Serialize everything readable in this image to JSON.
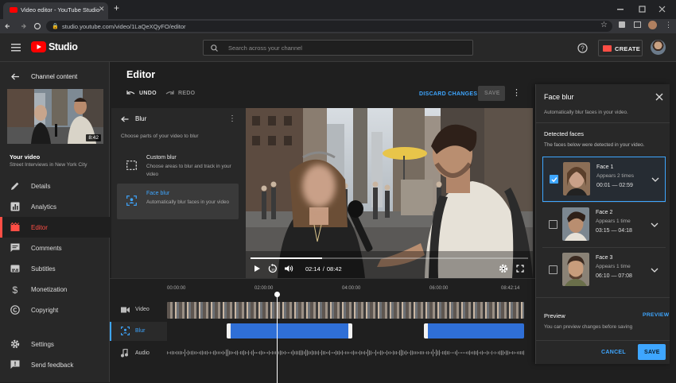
{
  "browser": {
    "tab_title": "Video editor - YouTube Studio",
    "url": "studio.youtube.com/video/1LaQeXQyFO/editor"
  },
  "header": {
    "logo_text": "Studio",
    "search_placeholder": "Search across your channel",
    "create_label": "CREATE"
  },
  "sidebar": {
    "back_label": "Channel content",
    "video_duration": "8:42",
    "your_video_label": "Your video",
    "video_title": "Street Interviews in New York City",
    "items": [
      {
        "label": "Details",
        "icon": "pencil-icon"
      },
      {
        "label": "Analytics",
        "icon": "analytics-icon"
      },
      {
        "label": "Editor",
        "icon": "editor-icon"
      },
      {
        "label": "Comments",
        "icon": "comments-icon"
      },
      {
        "label": "Subtitles",
        "icon": "subtitles-icon"
      },
      {
        "label": "Monetization",
        "icon": "dollar-icon"
      },
      {
        "label": "Copyright",
        "icon": "copyright-icon"
      }
    ],
    "bottom_items": [
      {
        "label": "Settings",
        "icon": "gear-icon"
      },
      {
        "label": "Send feedback",
        "icon": "feedback-icon"
      }
    ]
  },
  "editor": {
    "title": "Editor",
    "undo_label": "UNDO",
    "redo_label": "REDO",
    "discard_label": "DISCARD CHANGES",
    "save_label": "SAVE"
  },
  "blur_panel": {
    "title": "Blur",
    "subtitle": "Choose parts of your video to blur",
    "options": [
      {
        "title": "Custom blur",
        "desc": "Choose areas to blur and track in your video"
      },
      {
        "title": "Face blur",
        "desc": "Automatically blur faces in your video"
      }
    ]
  },
  "player": {
    "current_time": "02:14",
    "total_time": "08:42",
    "progress": 0.257
  },
  "timeline": {
    "ticks": [
      "00:00:00",
      "02:00:00",
      "04:00:00",
      "06:00:00",
      "08:42:14"
    ],
    "playhead_fraction": 0.307,
    "tracks": [
      {
        "label": "Video",
        "icon": "video-camera-icon"
      },
      {
        "label": "Blur",
        "icon": "face-blur-icon"
      },
      {
        "label": "Audio",
        "icon": "music-note-icon"
      }
    ],
    "blur_segments": [
      [
        0.168,
        0.52
      ],
      [
        0.72,
        1.0
      ]
    ]
  },
  "face_blur": {
    "title": "Face blur",
    "desc": "Automatically blur faces in your video.",
    "detected_title": "Detected faces",
    "detected_desc": "The faces below were detected in your video.",
    "faces": [
      {
        "name": "Face 1",
        "appears": "Appears 2 times",
        "time": "00:01 — 02:59",
        "checked": true
      },
      {
        "name": "Face 2",
        "appears": "Appears 1 time",
        "time": "03:15 — 04:18",
        "checked": false
      },
      {
        "name": "Face 3",
        "appears": "Appears 1 time",
        "time": "06:10 — 07:08",
        "checked": false
      }
    ],
    "preview_title": "Preview",
    "preview_link": "PREVIEW",
    "preview_desc": "You can preview changes before saving",
    "cancel_label": "CANCEL",
    "save_label": "SAVE"
  },
  "colors": {
    "accent_blue": "#3ea6ff",
    "brand_red": "#ff0000",
    "active_red": "#ff4e45",
    "blur_segment": "#2f6fd6"
  }
}
